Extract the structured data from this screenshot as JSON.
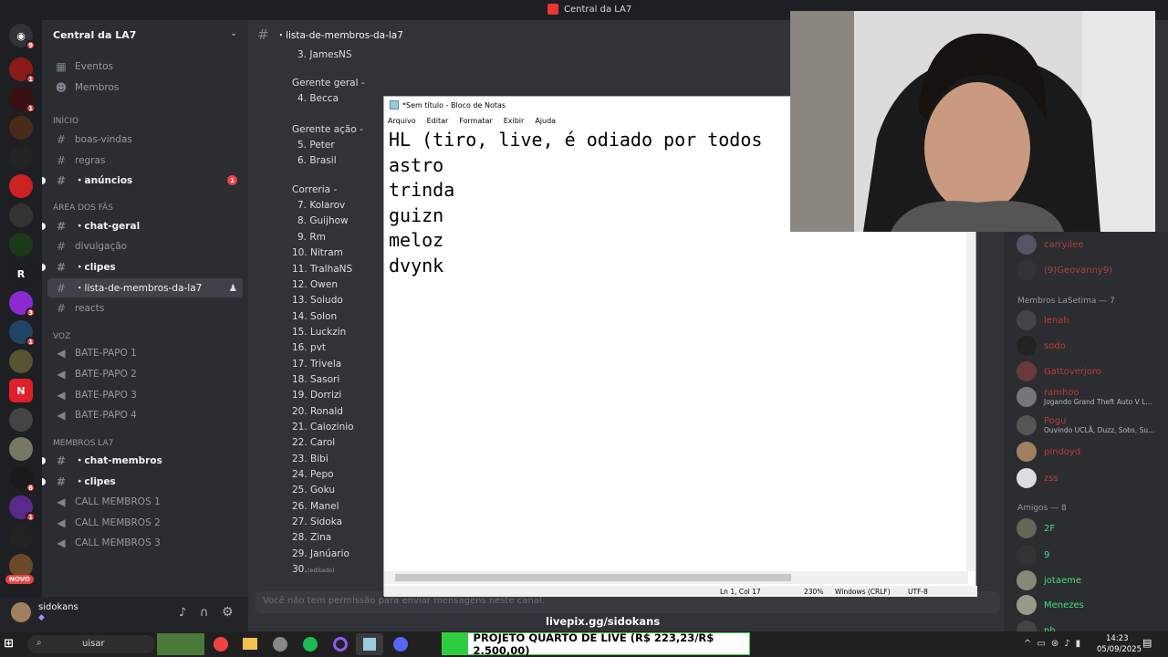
{
  "window": {
    "title": "Central da LA7"
  },
  "server": {
    "name": "Central da LA7"
  },
  "rail": [
    {
      "badge": "9"
    },
    {
      "badge": "1"
    },
    {
      "badge": "1"
    },
    {
      "badge": ""
    },
    {
      "badge": ""
    },
    {
      "badge": ""
    },
    {
      "badge": ""
    },
    {
      "badge": ""
    },
    {
      "letter": "R"
    },
    {
      "badge": "3"
    },
    {
      "badge": "1"
    },
    {
      "badge": ""
    },
    {
      "letter": "N"
    },
    {
      "badge": ""
    },
    {
      "badge": ""
    },
    {
      "badge": "6"
    },
    {
      "badge": "1"
    },
    {
      "badge": ""
    },
    {
      "badge": ""
    },
    {
      "badge": "NOVO"
    }
  ],
  "nav": {
    "events": "Eventos",
    "members": "Membros"
  },
  "categories": {
    "inicio": "INÍCIO",
    "area": "ÁREA DOS FÃS",
    "voz": "VOZ",
    "membros": "MEMBROS LA7"
  },
  "channels": {
    "boas_vindas": "boas-vindas",
    "regras": "regras",
    "anuncios": "・anúncios",
    "anuncios_badge": "1",
    "chat_geral": "・chat-geral",
    "divulgacao": "divulgação",
    "clipes": "・clipes",
    "lista": "・lista-de-membros-da-la7",
    "reacts": "reacts",
    "bp1": "BATE-PAPO 1",
    "bp2": "BATE-PAPO 2",
    "bp3": "BATE-PAPO 3",
    "bp4": "BATE-PAPO 4",
    "chat_membros": "・chat-membros",
    "clipes2": "・clipes",
    "cm1": "CALL MEMBROS 1",
    "cm2": "CALL MEMBROS 2",
    "cm3": "CALL MEMBROS 3"
  },
  "user": {
    "name": "sidokans"
  },
  "header": {
    "channel": "・lista-de-membros-da-la7"
  },
  "message_lines": [
    "3. JamesNS",
    "Gerente geral -",
    "4. Becca",
    "Gerente ação -",
    "5. Peter",
    "6. Brasil",
    "Correria -",
    "7. Kolarov",
    "8. Guijhow",
    "9. Rm",
    "10. Nitram",
    "11. TralhaNS",
    "12. Owen",
    "13. Soiudo",
    "14. Solon",
    "15. Luckzin",
    "16. pvt",
    "17. Trivela",
    "18. Sasori",
    "19. Dorrizi",
    "20. Ronald",
    "21. Caiozinio",
    "22. Carol",
    "23. Bibi",
    "24. Pepo",
    "25. Goku",
    "26. Manel",
    "27. Sidoka",
    "28. Zina",
    "29. Janúario",
    "30."
  ],
  "edited": "(editado)",
  "composer": {
    "placeholder": "Você não tem permissão para enviar mensagens neste canal."
  },
  "notepad": {
    "title": "*Sem título - Bloco de Notas",
    "menu": [
      "Arquivo",
      "Editar",
      "Formatar",
      "Exibir",
      "Ajuda"
    ],
    "text": "HL (tiro, live, é odiado por todos\nastro\ntrinda\nguizn\nmeloz\ndvynk",
    "status": {
      "pos": "Ln 1, Col 17",
      "zoom": "230%",
      "eol": "Windows (CRLF)",
      "enc": "UTF-8"
    }
  },
  "members_panel": {
    "top": [
      {
        "name": "carryilee"
      },
      {
        "name": "(9)Geovanny9)"
      }
    ],
    "cat1": "Membros LaSetima — 7",
    "list1": [
      {
        "name": "lenah",
        "status": ""
      },
      {
        "name": "sodo",
        "status": ""
      },
      {
        "name": "Gattoverjoro",
        "status": ""
      },
      {
        "name": "ramhoo",
        "status": "Jogando Grand Theft Auto V L..."
      },
      {
        "name": "Pogu",
        "status": "Ouvindo UCLÃ, Duzz, Sobs, Su..."
      },
      {
        "name": "pindoyd",
        "status": ""
      },
      {
        "name": "zss",
        "status": ""
      }
    ],
    "cat2": "Amigos — 8",
    "list2": [
      {
        "name": "2F"
      },
      {
        "name": "9"
      },
      {
        "name": "jotaeme"
      },
      {
        "name": "Menezes"
      },
      {
        "name": "nh"
      }
    ]
  },
  "overlay": {
    "livepix": "livepix.gg/sidokans",
    "goal": "PROJETO QUARTO DE LIVE (R$ 223,23/R$ 2.500,00)",
    "goal_progress": 0.089
  },
  "taskbar": {
    "search": "uisar",
    "time": "14:23",
    "date": "05/09/2025"
  }
}
